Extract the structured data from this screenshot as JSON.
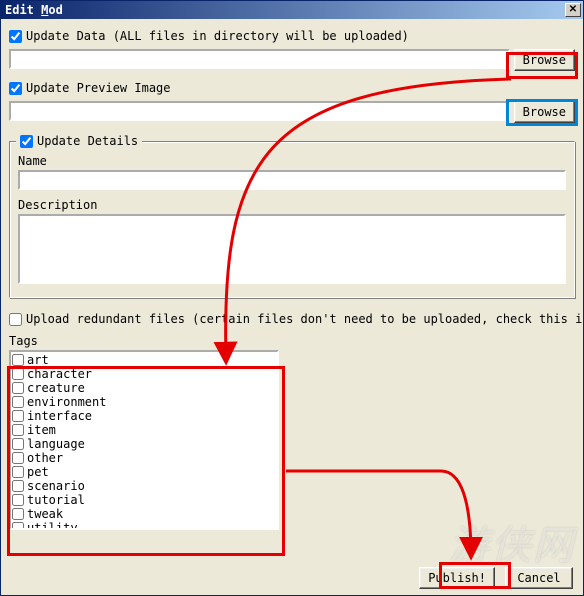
{
  "window": {
    "title_prefix": "Edit ",
    "title_accel": "M",
    "title_suffix": "od",
    "close_glyph": "✕"
  },
  "updateData": {
    "label": "Update Data (ALL files in directory will be uploaded)",
    "checked": true,
    "path": "",
    "browse": "Browse"
  },
  "previewImage": {
    "label": "Update Preview Image",
    "checked": true,
    "path": "",
    "browse": "Browse"
  },
  "details": {
    "groupLabel": "Update Details",
    "checked": true,
    "nameLabel": "Name",
    "nameValue": "",
    "descLabel": "Description",
    "descValue": ""
  },
  "redundant": {
    "label": "Upload redundant files (certain files don't need to be uploaded, check this if you want them to)",
    "checked": false
  },
  "tags": {
    "label": "Tags",
    "items": [
      "art",
      "character",
      "creature",
      "environment",
      "interface",
      "item",
      "language",
      "other",
      "pet",
      "scenario",
      "tutorial",
      "tweak",
      "utility"
    ]
  },
  "footer": {
    "publish": "Publish!",
    "cancel": "Cancel"
  },
  "watermark": "游侠网"
}
